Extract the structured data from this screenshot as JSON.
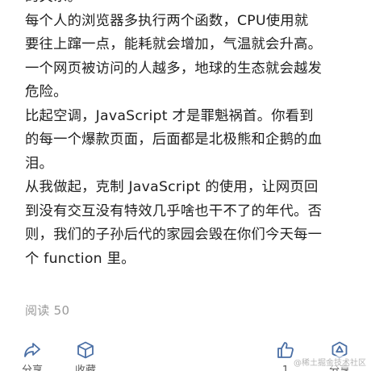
{
  "article": {
    "lines": [
      "的关系。",
      "每个人的浏览器多执行两个函数，CPU使用就",
      "要往上蹿一点，能耗就会增加，气温就会升高。",
      "一个网页被访问的人越多，地球的生态就会越发",
      "危险。",
      "比起空调，JavaScript 才是罪魁祸首。你看到",
      "的每一个爆款页面，后面都是北极熊和企鹅的血",
      "泪。",
      "从我做起，克制 JavaScript 的使用，让网页回",
      "到没有交互没有特效几乎啥也干不了的年代。否",
      "则，我们的子孙后代的家园会毁在你们今天每一",
      "个 function 里。"
    ]
  },
  "stats": {
    "read_count": "阅读 50"
  },
  "actions": {
    "share_label": "分享",
    "favorite_label": "收藏",
    "like_count": "1",
    "share_wechat_label": "分享"
  },
  "watermark": "@稀土掘金技术社区",
  "icons": {
    "share": "share-arrow-icon",
    "favorite": "cube-icon",
    "like": "thumbs-up-icon",
    "more_share": "hexagon-share-icon"
  },
  "colors": {
    "text": "#1f1f1f",
    "muted": "#9a9a9a",
    "icon": "#4a6fa5"
  }
}
